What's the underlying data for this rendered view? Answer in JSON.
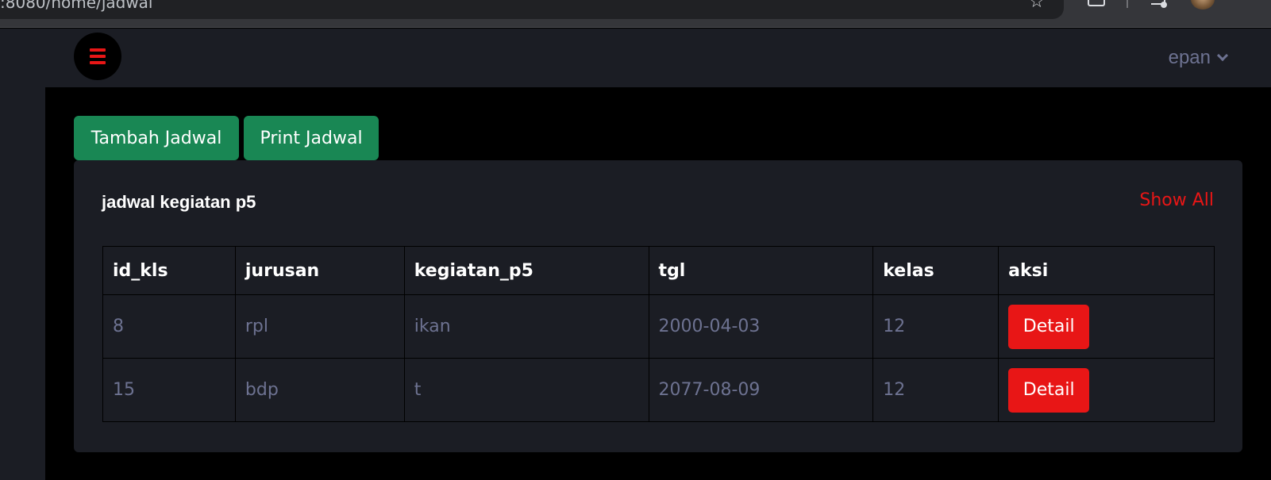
{
  "browser": {
    "url": ":8080/home/jadwal"
  },
  "navbar": {
    "menu_icon": "hamburger-icon",
    "user_name": "epan",
    "user_menu_icon": "chevron-down-icon"
  },
  "actions": {
    "tambah_label": "Tambah Jadwal",
    "print_label": "Print Jadwal"
  },
  "card": {
    "title": "jadwal kegiatan p5",
    "show_all_label": "Show All"
  },
  "table": {
    "headers": [
      "id_kls",
      "jurusan",
      "kegiatan_p5",
      "tgl",
      "kelas",
      "aksi"
    ],
    "rows": [
      {
        "id_kls": "8",
        "jurusan": "rpl",
        "kegiatan_p5": "ikan",
        "tgl": "2000-04-03",
        "kelas": "12",
        "aksi": "Detail"
      },
      {
        "id_kls": "15",
        "jurusan": "bdp",
        "kegiatan_p5": "t",
        "tgl": "2077-08-09",
        "kelas": "12",
        "aksi": "Detail"
      }
    ]
  },
  "colors": {
    "page_bg": "#000000",
    "panel_bg": "#1b1d24",
    "success_green": "#198754",
    "danger_red": "#e81616",
    "muted_text": "#6d7291"
  }
}
